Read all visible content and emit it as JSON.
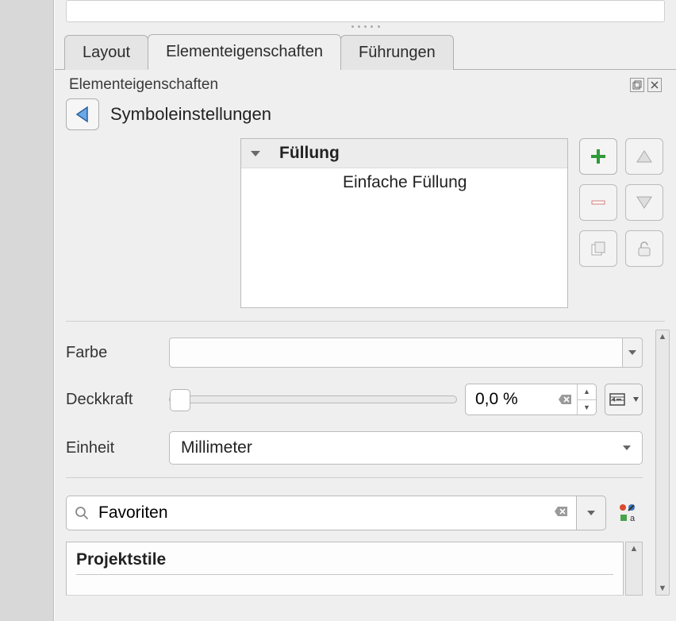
{
  "tabs": {
    "layout": "Layout",
    "properties": "Elementeigenschaften",
    "guides": "Führungen"
  },
  "panel": {
    "title": "Elementeigenschaften"
  },
  "symbol": {
    "title": "Symboleinstellungen"
  },
  "tree": {
    "parent": "Füllung",
    "child": "Einfache Füllung"
  },
  "form": {
    "color_label": "Farbe",
    "opacity_label": "Deckkraft",
    "opacity_value": "0,0 %",
    "unit_label": "Einheit",
    "unit_value": "Millimeter"
  },
  "search": {
    "value": "Favoriten"
  },
  "styles": {
    "header": "Projektstile"
  }
}
